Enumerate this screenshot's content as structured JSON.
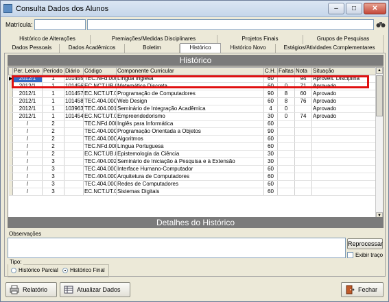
{
  "window": {
    "title": "Consulta Dados dos Alunos",
    "buttons": {
      "minimize": "–",
      "maximize": "□",
      "close": "✕"
    }
  },
  "matricula": {
    "label": "Matrícula:",
    "value": "",
    "name_value": ""
  },
  "tabs_row1": [
    "Histórico de Alterações",
    "Premiações/Medidas Disciplinares",
    "Projetos Finais",
    "Grupos de Pesquisas"
  ],
  "tabs_row2": [
    "Dados Pessoais",
    "Dados Acadêmicos",
    "Boletim",
    "Histórico",
    "Histórico Novo",
    "Estágios/Atividades Complementares"
  ],
  "active_tab": "Histórico",
  "historico": {
    "header": "Histórico",
    "columns": [
      "Per. Letivo",
      "Período",
      "Diário",
      "Código",
      "Componente Curricular",
      "C.H.",
      "Faltas",
      "Nota",
      "Situação"
    ],
    "rows": [
      [
        "2012/1",
        "1",
        "101455",
        "TEC.NFd.0004",
        "Língua Inglesa",
        "60",
        "",
        "94",
        "Aproveit. Disciplina"
      ],
      [
        "2012/1",
        "1",
        "101456",
        "EC.NCT.UB.00",
        "Matemática Discreta",
        "60",
        "0",
        "71",
        "Aprovado"
      ],
      [
        "2012/1",
        "1",
        "101457",
        "EC.NCT.UT.00",
        "Programação de Computadores",
        "90",
        "8",
        "60",
        "Aprovado"
      ],
      [
        "2012/1",
        "1",
        "101458",
        "TEC.404.0001",
        "Web Design",
        "60",
        "8",
        "76",
        "Aprovado"
      ],
      [
        "2012/1",
        "1",
        "103963",
        "TEC.404.0019",
        "Seminário de Integração Acadêmica",
        "4",
        "0",
        "",
        "Aprovado"
      ],
      [
        "2012/1",
        "1",
        "101454",
        "EC.NCT.UT.00",
        "Empreendedorismo",
        "30",
        "0",
        "74",
        "Aprovado"
      ],
      [
        "/",
        "2",
        "",
        "TEC.NFd.0006",
        "Inglês para Informática",
        "60",
        "",
        "",
        ""
      ],
      [
        "/",
        "2",
        "",
        "TEC.404.0002",
        "Programação Orientada a Objetos",
        "90",
        "",
        "",
        ""
      ],
      [
        "/",
        "2",
        "",
        "TEC.404.0003",
        "Algoritmos",
        "60",
        "",
        "",
        ""
      ],
      [
        "/",
        "2",
        "",
        "TEC.NFd.0001",
        "Língua Portuguesa",
        "60",
        "",
        "",
        ""
      ],
      [
        "/",
        "2",
        "",
        "EC.NCT.UB.00",
        "Epistemologia da Ciência",
        "30",
        "",
        "",
        ""
      ],
      [
        "/",
        "3",
        "",
        "TEC.404.0023",
        "Seminário de Iniciação à Pesquisa e à Extensão",
        "30",
        "",
        "",
        ""
      ],
      [
        "/",
        "3",
        "",
        "TEC.404.0006",
        "Interface Humano-Computador",
        "60",
        "",
        "",
        ""
      ],
      [
        "/",
        "3",
        "",
        "TEC.404.0005",
        "Arquitetura de Computadores",
        "60",
        "",
        "",
        ""
      ],
      [
        "/",
        "3",
        "",
        "TEC.404.0004",
        "Redes de Computadores",
        "60",
        "",
        "",
        ""
      ],
      [
        "/",
        "3",
        "",
        "EC.NCT.UT.00",
        "Sistemas Digitais",
        "60",
        "",
        "",
        ""
      ]
    ]
  },
  "detalhes": {
    "header": "Detalhes do Histórico",
    "observacoes_label": "Observações",
    "observacoes_value": "",
    "reprocessar": "Reprocessar",
    "exibir_traco": "Exibir traço",
    "tipo_label": "Tipo:",
    "tipo_options": [
      "Histórico Parcial",
      "Histórico Final"
    ],
    "tipo_selected": "Histórico Final"
  },
  "footer": {
    "relatorio": "Relatório",
    "atualizar": "Atualizar Dados",
    "fechar": "Fechar"
  },
  "colors": {
    "selected_row": "#3169c6",
    "highlight_box": "#e01010",
    "section_header": "#7b7b7b"
  }
}
